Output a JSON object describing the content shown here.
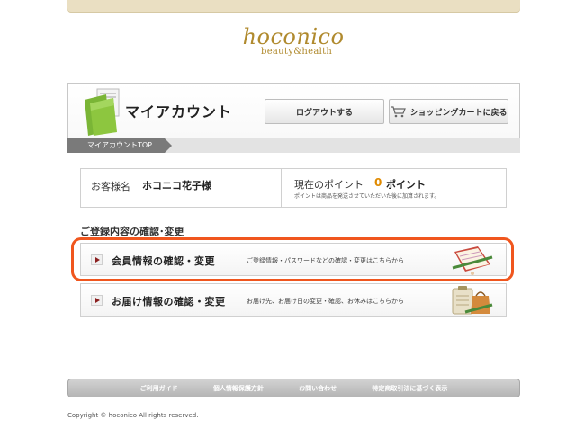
{
  "brand": {
    "logo_main": "hoconico",
    "logo_sub": "beauty&health"
  },
  "header": {
    "title": "マイアカウント",
    "logout_label": "ログアウトする",
    "cart_label": "ショッピングカートに戻る"
  },
  "breadcrumb": {
    "current": "マイアカウントTOP"
  },
  "info": {
    "customer_label": "お客様名",
    "customer_name": "ホコニコ花子様",
    "points_label": "現在のポイント",
    "points_value": "0",
    "points_unit": "ポイント",
    "points_note": "ポイントは商品を発送させていただいた後に加算されます。"
  },
  "section": {
    "title": "ご登録内容の確認･変更"
  },
  "menu": [
    {
      "label": "会員情報の確認・変更",
      "desc": "ご登録情報・パスワードなどの確認・変更はこちらから"
    },
    {
      "label": "お届け情報の確認・変更",
      "desc": "お届け先、お届け日の変更・確認、お休みはこちらから"
    }
  ],
  "footer": {
    "links": [
      "ご利用ガイド",
      "個人情報保護方針",
      "お問い合わせ",
      "特定商取引法に基づく表示"
    ],
    "copyright": "Copyright © hoconico All rights reserved."
  },
  "colors": {
    "accent_orange": "#f0561e",
    "points_orange": "#e08a00",
    "logo_gold": "#b08a2e",
    "folder_green": "#8dc63f"
  }
}
